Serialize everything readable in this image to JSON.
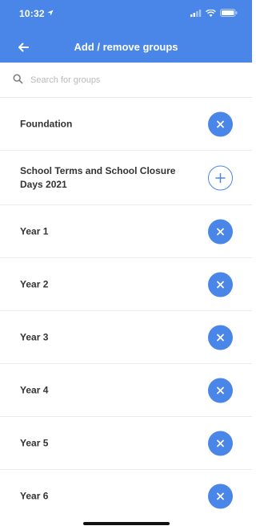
{
  "status_bar": {
    "time": "10:32"
  },
  "header": {
    "title": "Add / remove groups",
    "back_icon": "arrow-left-icon",
    "color": "#4a86e8"
  },
  "search": {
    "placeholder": "Search for groups",
    "icon": "search-icon"
  },
  "groups": [
    {
      "label": "Foundation",
      "action": "remove"
    },
    {
      "label": "School Terms and School Closure Days 2021",
      "action": "add"
    },
    {
      "label": "Year 1",
      "action": "remove"
    },
    {
      "label": "Year 2",
      "action": "remove"
    },
    {
      "label": "Year 3",
      "action": "remove"
    },
    {
      "label": "Year 4",
      "action": "remove"
    },
    {
      "label": "Year 5",
      "action": "remove"
    },
    {
      "label": "Year 6",
      "action": "remove"
    }
  ]
}
